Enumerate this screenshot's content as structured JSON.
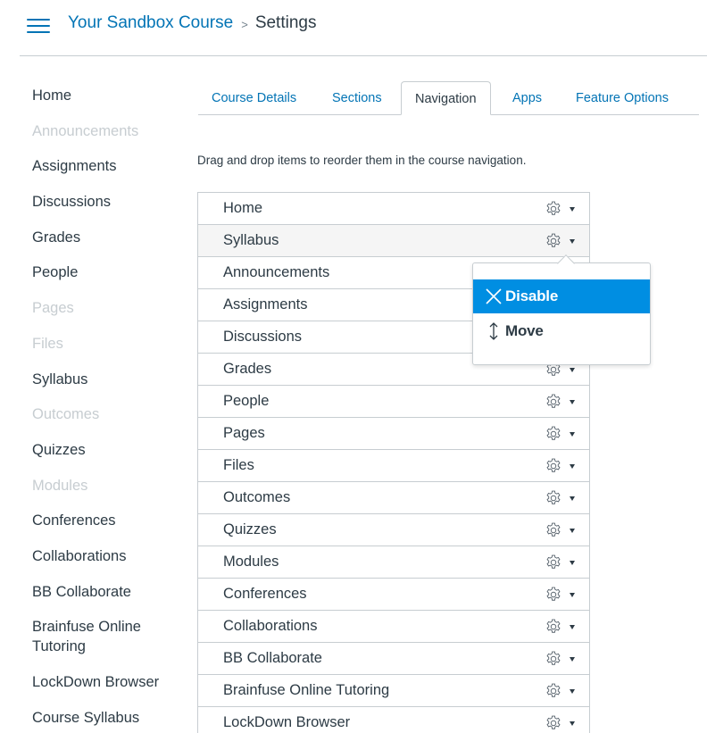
{
  "header": {
    "menu_icon": "hamburger-icon",
    "breadcrumb": {
      "course": "Your Sandbox Course",
      "separator": ">",
      "current": "Settings"
    }
  },
  "left_nav": {
    "items": [
      {
        "label": "Home",
        "hidden": false
      },
      {
        "label": "Announcements",
        "hidden": true
      },
      {
        "label": "Assignments",
        "hidden": false
      },
      {
        "label": "Discussions",
        "hidden": false
      },
      {
        "label": "Grades",
        "hidden": false
      },
      {
        "label": "People",
        "hidden": false
      },
      {
        "label": "Pages",
        "hidden": true
      },
      {
        "label": "Files",
        "hidden": true
      },
      {
        "label": "Syllabus",
        "hidden": false
      },
      {
        "label": "Outcomes",
        "hidden": true
      },
      {
        "label": "Quizzes",
        "hidden": false
      },
      {
        "label": "Modules",
        "hidden": true
      },
      {
        "label": "Conferences",
        "hidden": false
      },
      {
        "label": "Collaborations",
        "hidden": false
      },
      {
        "label": "BB Collaborate",
        "hidden": false
      },
      {
        "label": "Brainfuse Online Tutoring",
        "hidden": false
      },
      {
        "label": "LockDown Browser",
        "hidden": false
      },
      {
        "label": "Course Syllabus",
        "hidden": false,
        "clipped": true
      }
    ]
  },
  "tabs": [
    {
      "label": "Course Details",
      "active": false
    },
    {
      "label": "Sections",
      "active": false
    },
    {
      "label": "Navigation",
      "active": true
    },
    {
      "label": "Apps",
      "active": false
    },
    {
      "label": "Feature Options",
      "active": false
    }
  ],
  "navigation_tab": {
    "description": "Drag and drop items to reorder them in the course navigation.",
    "items": [
      {
        "label": "Home"
      },
      {
        "label": "Syllabus",
        "highlighted": true
      },
      {
        "label": "Announcements"
      },
      {
        "label": "Assignments"
      },
      {
        "label": "Discussions"
      },
      {
        "label": "Grades"
      },
      {
        "label": "People"
      },
      {
        "label": "Pages"
      },
      {
        "label": "Files"
      },
      {
        "label": "Outcomes"
      },
      {
        "label": "Quizzes"
      },
      {
        "label": "Modules"
      },
      {
        "label": "Conferences"
      },
      {
        "label": "Collaborations"
      },
      {
        "label": "BB Collaborate"
      },
      {
        "label": "Brainfuse Online Tutoring"
      },
      {
        "label": "LockDown Browser"
      }
    ],
    "row_icons": {
      "settings": "gear-icon",
      "dropdown": "caret-down-icon"
    }
  },
  "popover_menu": {
    "for_item": "Syllabus",
    "items": [
      {
        "label": "Disable",
        "icon": "x-icon",
        "selected": true
      },
      {
        "label": "Move",
        "icon": "updown-arrow-icon",
        "selected": false
      }
    ]
  },
  "colors": {
    "link_blue": "#0374b5",
    "menu_highlight": "#008ee2",
    "text": "#2d3b45",
    "disabled_text": "#c7cdd1",
    "border": "#c7cdd1"
  }
}
